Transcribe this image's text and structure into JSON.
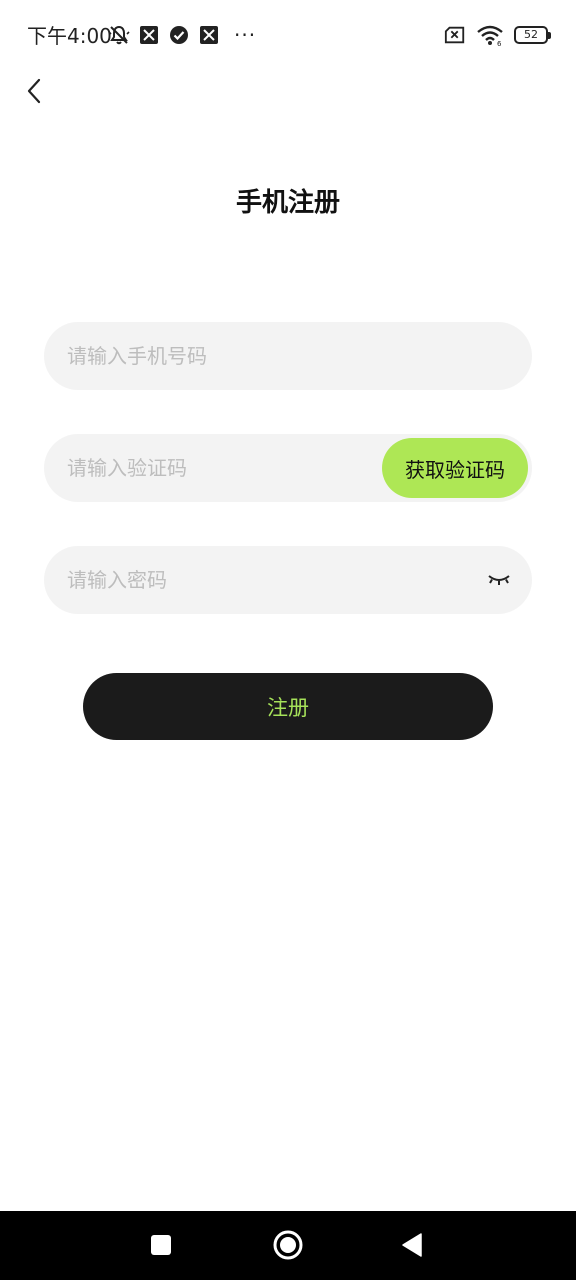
{
  "status_bar": {
    "time": "下午4:00",
    "battery": "52",
    "icons_left": [
      "bell-off-icon",
      "app-notification-icon",
      "check-circle-icon",
      "app-notification-icon",
      "more-dots-icon"
    ],
    "icons_right": [
      "sim-off-icon",
      "wifi-icon",
      "battery-icon"
    ]
  },
  "header": {
    "back_icon": "chevron-left-icon",
    "title": "手机注册"
  },
  "form": {
    "phone_placeholder": "请输入手机号码",
    "code_placeholder": "请输入验证码",
    "get_code_label": "获取验证码",
    "password_placeholder": "请输入密码",
    "password_toggle_icon": "eye-closed-icon",
    "register_label": "注册"
  },
  "colors": {
    "accent_green": "#aee755",
    "register_text": "#a6e25a",
    "button_dark": "#1b1b1b",
    "field_bg": "#f3f3f3",
    "placeholder": "#bdbdbd"
  },
  "nav_bar": {
    "recents_icon": "square-icon",
    "home_icon": "circle-home-icon",
    "back_icon": "triangle-back-icon"
  }
}
